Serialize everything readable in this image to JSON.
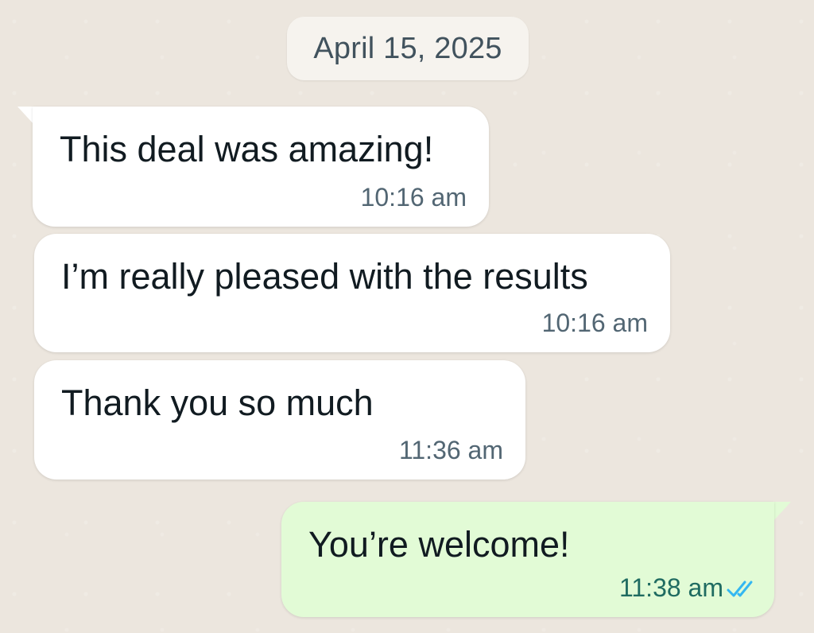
{
  "date_divider": "April 15, 2025",
  "messages": [
    {
      "direction": "incoming",
      "text": "This deal was amazing!",
      "time": "10:16 am"
    },
    {
      "direction": "incoming",
      "text": "I’m really pleased with the results",
      "time": "10:16 am"
    },
    {
      "direction": "incoming",
      "text": "Thank you so much",
      "time": "11:36 am"
    },
    {
      "direction": "outgoing",
      "text": "You’re welcome!",
      "time": "11:38 am",
      "status": "read"
    }
  ],
  "colors": {
    "incoming_bubble": "#ffffff",
    "outgoing_bubble": "#e2fbd6",
    "read_ticks": "#34b7f1",
    "background": "#ece6de"
  },
  "icons": {
    "read_receipt": "double-check-icon"
  }
}
